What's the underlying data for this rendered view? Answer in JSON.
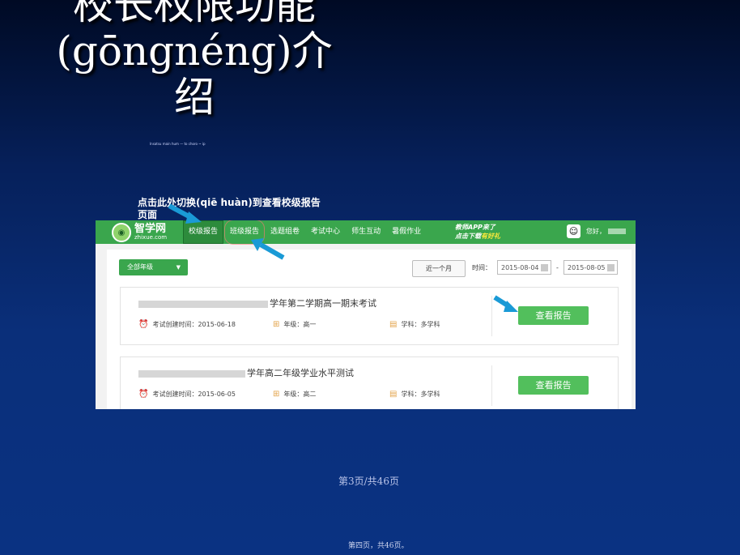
{
  "slide": {
    "title_line1": "校长权限功能",
    "title_line2": "(gōngnéng)介",
    "title_line3": "绍",
    "caption": "Insatsu main hum — to choro ~ ip",
    "annotation_1": "点击此处切换(qiē huàn)到查看校级报告页面",
    "page_number": "第3页/共46页",
    "footer": "第四页，共46页。"
  },
  "app": {
    "logo_name": "智学网",
    "logo_sub": "zhixue.com",
    "nav": [
      "校级报告",
      "班级报告",
      "选题组卷",
      "考试中心",
      "师生互动",
      "暑假作业"
    ],
    "promo_line1": "教师APP来了",
    "promo_line2a": "点击下载",
    "promo_line2b": "有好礼",
    "greeting": "您好，"
  },
  "filters": {
    "grade": "全部年级",
    "recent": "近一个月",
    "time_label": "时间：",
    "date_from": "2015-08-04",
    "date_sep": "-",
    "date_to": "2015-08-05"
  },
  "exams": [
    {
      "title": "学年第二学期高一期末考试",
      "created": "考试创建时间：2015-06-18",
      "grade": "年级：高一",
      "subject": "学科：多学科",
      "button": "查看报告"
    },
    {
      "title": "学年高二年级学业水平测试",
      "created": "考试创建时间：2015-06-05",
      "grade": "年级：高二",
      "subject": "学科：多学科",
      "button": "查看报告"
    }
  ],
  "colors": {
    "nav_green": "#3aa64d",
    "button_green": "#52bf5c",
    "arrow_blue": "#1a9ad6"
  }
}
